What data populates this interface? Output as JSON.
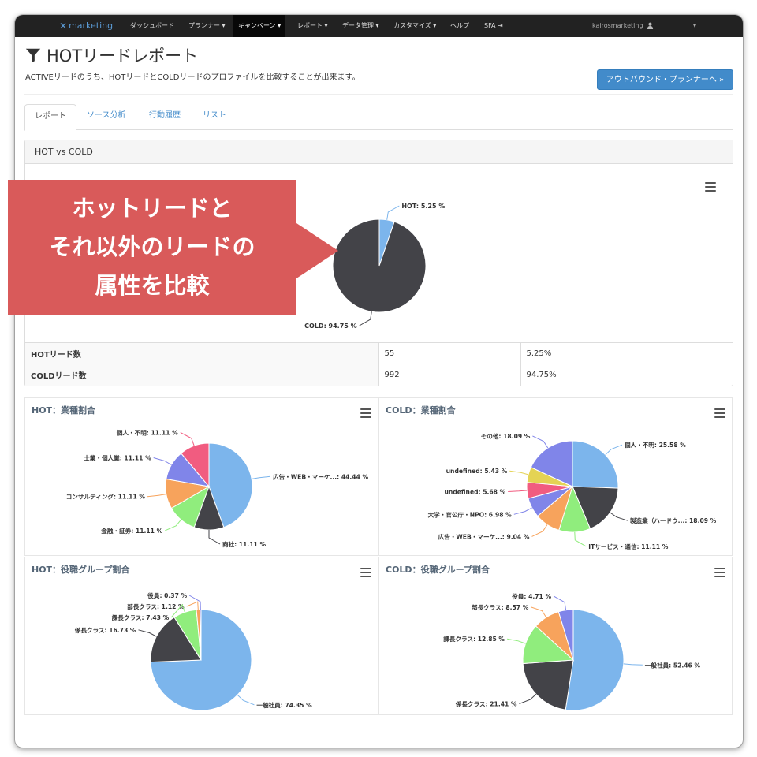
{
  "navbar": {
    "brand": "marketing",
    "items": [
      "ダッシュボード",
      "プランナー",
      "キャンペーン",
      "レポート",
      "データ管理",
      "カスタマイズ",
      "ヘルプ",
      "SFA"
    ],
    "active": "キャンペーン",
    "user": "kairosmarketing"
  },
  "header": {
    "title": "HOTリードレポート",
    "description": "ACTIVEリードのうち、HOTリードとCOLDリードのプロファイルを比較することが出来ます。",
    "outbound_button": "アウトバウンド・プランナーへ »"
  },
  "tabs": [
    "レポート",
    "ソース分析",
    "行動履歴",
    "リスト"
  ],
  "main_panel": {
    "title": "HOT vs COLD",
    "table": [
      {
        "label": "HOTリード数",
        "count": "55",
        "percent": "5.25%"
      },
      {
        "label": "COLDリード数",
        "count": "992",
        "percent": "94.75%"
      }
    ]
  },
  "callout": {
    "lines": [
      "ホットリードと",
      "それ以外のリードの",
      "属性を比較"
    ]
  },
  "chart_data": [
    {
      "type": "pie",
      "title": "",
      "series": [
        {
          "values": [
            {
              "name": "HOT",
              "label": "HOT: 5.25 %",
              "value": 5.25,
              "color": "#7cb5ec"
            },
            {
              "name": "COLD",
              "label": "COLD: 94.75 %",
              "value": 94.75,
              "color": "#434348"
            }
          ]
        }
      ]
    },
    {
      "type": "pie",
      "title": "HOT：業種割合",
      "series": [
        {
          "values": [
            {
              "label": "広告・WEB・マーケ...: 44.44 %",
              "value": 44.44,
              "color": "#7cb5ec"
            },
            {
              "label": "商社: 11.11 %",
              "value": 11.11,
              "color": "#434348"
            },
            {
              "label": "金融・証券: 11.11 %",
              "value": 11.11,
              "color": "#90ed7d"
            },
            {
              "label": "コンサルティング: 11.11 %",
              "value": 11.11,
              "color": "#f7a35c"
            },
            {
              "label": "士業・個人業: 11.11 %",
              "value": 11.11,
              "color": "#8085e9"
            },
            {
              "label": "個人・不明: 11.11 %",
              "value": 11.11,
              "color": "#f15c80"
            }
          ]
        }
      ]
    },
    {
      "type": "pie",
      "title": "COLD：業種割合",
      "series": [
        {
          "values": [
            {
              "label": "個人・不明: 25.58 %",
              "value": 25.58,
              "color": "#7cb5ec"
            },
            {
              "label": "製造業（ハードウ...: 18.09 %",
              "value": 18.09,
              "color": "#434348"
            },
            {
              "label": "ITサービス・通信: 11.11 %",
              "value": 11.11,
              "color": "#90ed7d"
            },
            {
              "label": "広告・WEB・マーケ...: 9.04 %",
              "value": 9.04,
              "color": "#f7a35c"
            },
            {
              "label": "大学・官公庁・NPO: 6.98 %",
              "value": 6.98,
              "color": "#8085e9"
            },
            {
              "label": "undefined: 5.68 %",
              "value": 5.68,
              "color": "#f15c80"
            },
            {
              "label": "undefined: 5.43 %",
              "value": 5.43,
              "color": "#e4d354"
            },
            {
              "label": "その他: 18.09 %",
              "value": 18.09,
              "color": "#8085e9"
            }
          ]
        }
      ]
    },
    {
      "type": "pie",
      "title": "HOT：役職グループ割合",
      "series": [
        {
          "values": [
            {
              "label": "一般社員: 74.35 %",
              "value": 74.35,
              "color": "#7cb5ec"
            },
            {
              "label": "係長クラス: 16.73 %",
              "value": 16.73,
              "color": "#434348"
            },
            {
              "label": "課長クラス: 7.43 %",
              "value": 7.43,
              "color": "#90ed7d"
            },
            {
              "label": "部長クラス: 1.12 %",
              "value": 1.12,
              "color": "#f7a35c"
            },
            {
              "label": "役員: 0.37 %",
              "value": 0.37,
              "color": "#8085e9"
            }
          ]
        }
      ]
    },
    {
      "type": "pie",
      "title": "COLD：役職グループ割合",
      "series": [
        {
          "values": [
            {
              "label": "一般社員: 52.46 %",
              "value": 52.46,
              "color": "#7cb5ec"
            },
            {
              "label": "係長クラス: 21.41 %",
              "value": 21.41,
              "color": "#434348"
            },
            {
              "label": "課長クラス: 12.85 %",
              "value": 12.85,
              "color": "#90ed7d"
            },
            {
              "label": "部長クラス: 8.57 %",
              "value": 8.57,
              "color": "#f7a35c"
            },
            {
              "label": "役員: 4.71 %",
              "value": 4.71,
              "color": "#8085e9"
            }
          ]
        }
      ]
    }
  ]
}
